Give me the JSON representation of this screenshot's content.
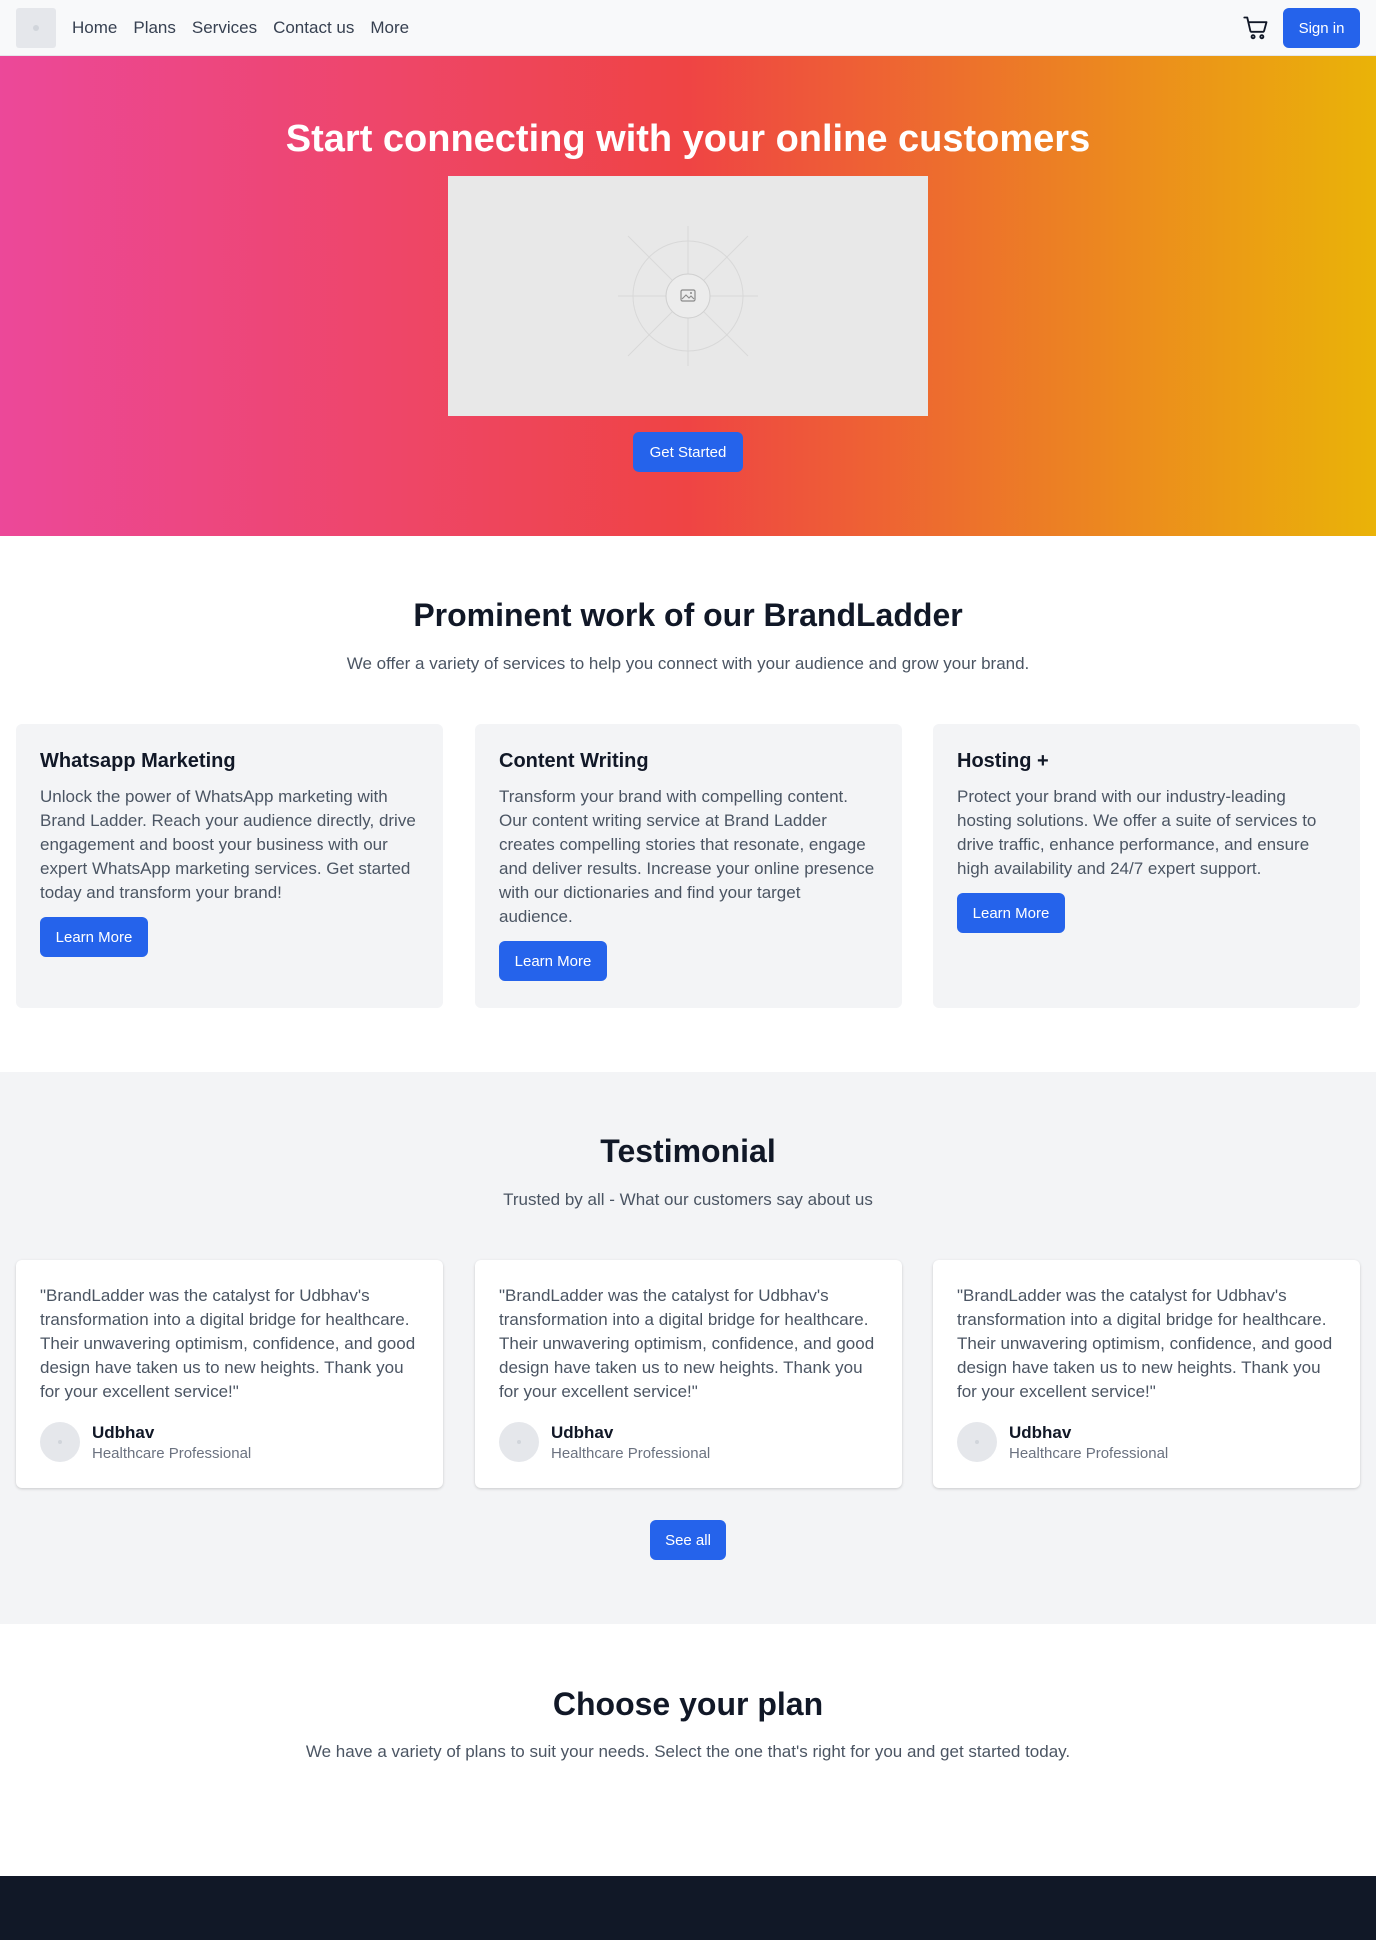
{
  "nav": {
    "links": [
      "Home",
      "Plans",
      "Services",
      "Contact us",
      "More"
    ],
    "signin_label": "Sign in",
    "cart_icon": "cart-icon",
    "logo": "logo-placeholder"
  },
  "hero": {
    "title": "Start connecting with your online customers",
    "image_icon": "image-placeholder-icon",
    "cta_label": "Get Started"
  },
  "services": {
    "title": "Prominent work of our BrandLadder",
    "subtitle": "We offer a variety of services to help you connect with your audience and grow your brand.",
    "cards": [
      {
        "title": "Whatsapp Marketing",
        "description": "Unlock the power of WhatsApp marketing with Brand Ladder. Reach your audience directly, drive engagement and boost your business with our expert WhatsApp marketing services. Get started today and transform your brand!",
        "button": "Learn More"
      },
      {
        "title": "Content Writing",
        "description": "Transform your brand with compelling content. Our content writing service at Brand Ladder creates compelling stories that resonate, engage and deliver results. Increase your online presence with our dictionaries and find your target audience.",
        "button": "Learn More"
      },
      {
        "title": "Hosting +",
        "description": "Protect your brand with our industry-leading hosting solutions. We offer a suite of services to drive traffic, enhance performance, and ensure high availability and 24/7 expert support.",
        "button": "Learn More"
      }
    ]
  },
  "testimonials": {
    "title": "Testimonial",
    "subtitle": "Trusted by all - What our customers say about us",
    "items": [
      {
        "quote": "\"BrandLadder was the catalyst for Udbhav's transformation into a digital bridge for healthcare. Their unwavering optimism, confidence, and good design have taken us to new heights. Thank you for your excellent service!\"",
        "name": "Udbhav",
        "role": "Healthcare Professional"
      },
      {
        "quote": "\"BrandLadder was the catalyst for Udbhav's transformation into a digital bridge for healthcare. Their unwavering optimism, confidence, and good design have taken us to new heights. Thank you for your excellent service!\"",
        "name": "Udbhav",
        "role": "Healthcare Professional"
      },
      {
        "quote": "\"BrandLadder was the catalyst for Udbhav's transformation into a digital bridge for healthcare. Their unwavering optimism, confidence, and good design have taken us to new heights. Thank you for your excellent service!\"",
        "name": "Udbhav",
        "role": "Healthcare Professional"
      }
    ],
    "see_all_label": "See all"
  },
  "plans": {
    "title": "Choose your plan",
    "subtitle": "We have a variety of plans to suit your needs. Select the one that's right for you and get started today."
  },
  "colors": {
    "primary": "#2563eb",
    "hero_start": "#ec4899",
    "hero_mid": "#ef4444",
    "hero_end": "#eab308",
    "footer": "#111827"
  }
}
